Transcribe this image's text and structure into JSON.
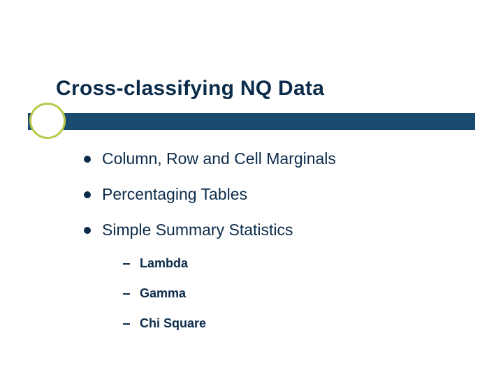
{
  "title": "Cross-classifying NQ Data",
  "bullets": [
    {
      "text": "Column, Row and Cell Marginals"
    },
    {
      "text": "Percentaging Tables"
    },
    {
      "text": "Simple Summary Statistics"
    }
  ],
  "subbullets": [
    {
      "text": "Lambda"
    },
    {
      "text": "Gamma"
    },
    {
      "text": "Chi Square"
    }
  ]
}
